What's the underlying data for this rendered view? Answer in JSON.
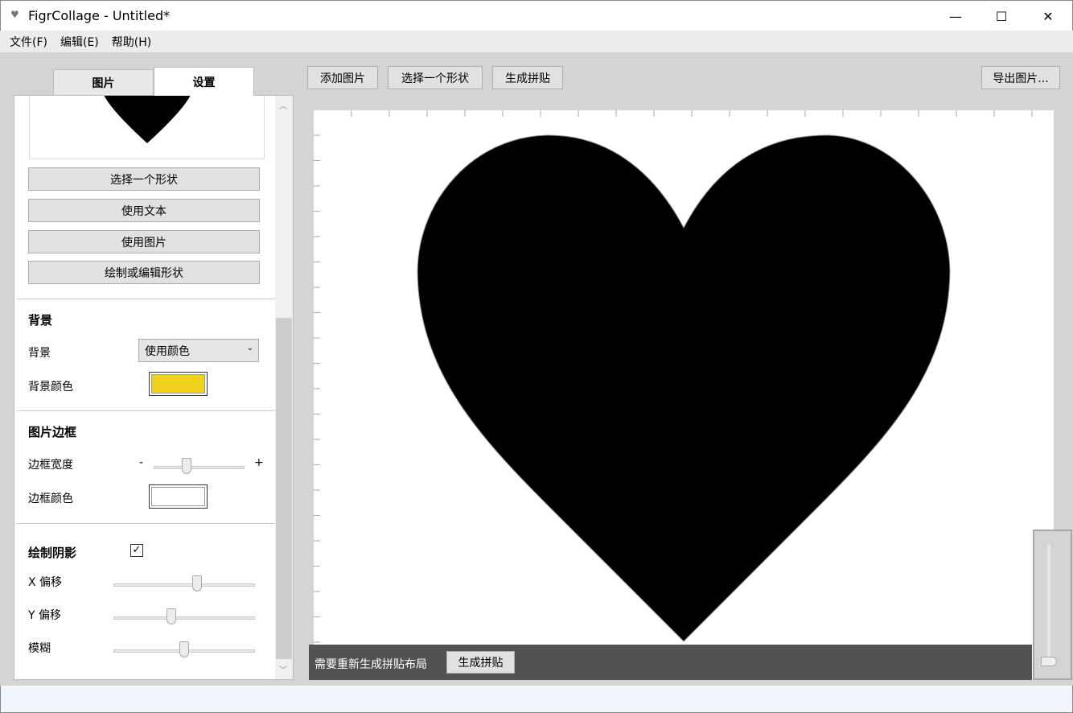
{
  "window": {
    "title": "FigrCollage - Untitled*",
    "minimize": "—",
    "maximize": "☐",
    "close": "✕"
  },
  "menu": [
    "文件(F)",
    "编辑(E)",
    "帮助(H)"
  ],
  "tabs": {
    "images": "图片",
    "settings": "设置"
  },
  "toolbar": {
    "add_image": "添加图片",
    "choose_shape": "选择一个形状",
    "generate": "生成拼贴",
    "export": "导出图片..."
  },
  "panel": {
    "shape_buttons": [
      "选择一个形状",
      "使用文本",
      "使用图片",
      "绘制或编辑形状"
    ],
    "background": {
      "heading": "背景",
      "bg_label": "背景",
      "bg_select": "使用颜色",
      "color_label": "背景颜色",
      "color": "#f0d21c"
    },
    "border": {
      "heading": "图片边框",
      "width_label": "边框宽度",
      "minus": "-",
      "plus": "+",
      "width_value": 0.35,
      "color_label": "边框颜色",
      "color": "#ffffff"
    },
    "shadow": {
      "heading": "绘制阴影",
      "checked": true,
      "x_label": "X 偏移",
      "x_value": 0.6,
      "y_label": "Y 偏移",
      "y_value": 0.4,
      "blur_label": "模糊",
      "blur_value": 0.5
    }
  },
  "notice": {
    "text": "需要重新生成拼贴布局",
    "button": "生成拼贴"
  },
  "zoom": {
    "value": 0.0
  }
}
